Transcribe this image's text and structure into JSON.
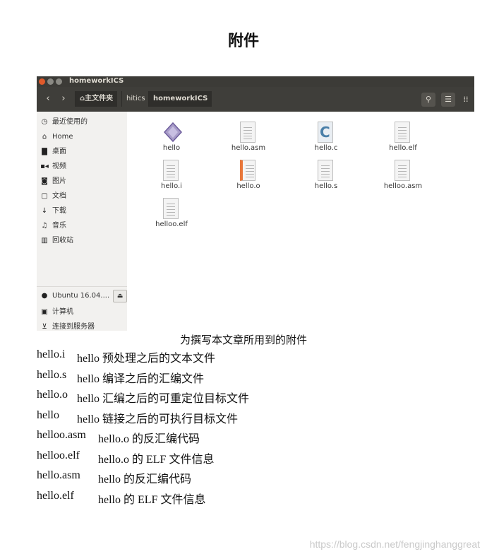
{
  "page": {
    "title": "附件",
    "caption": "为撰写本文章所用到的附件",
    "watermark": "https://blog.csdn.net/fengjinghanggreat"
  },
  "window": {
    "title": "homeworkICS",
    "toolbar": {
      "back_icon": "chevron-left-icon",
      "forward_icon": "chevron-right-icon",
      "breadcrumbs": [
        "主文件夹",
        "hitics",
        "homeworkICS"
      ],
      "search_icon": "search-icon",
      "list_view_icon": "list-view-icon",
      "grid_view_icon": "grid-view-icon"
    },
    "sidebar": {
      "items": [
        {
          "label": "最近使用的",
          "icon": "clock-icon"
        },
        {
          "label": "Home",
          "icon": "home-icon"
        },
        {
          "label": "桌面",
          "icon": "folder-icon"
        },
        {
          "label": "视频",
          "icon": "video-icon"
        },
        {
          "label": "图片",
          "icon": "camera-icon"
        },
        {
          "label": "文档",
          "icon": "document-icon"
        },
        {
          "label": "下载",
          "icon": "download-icon"
        },
        {
          "label": "音乐",
          "icon": "music-icon"
        },
        {
          "label": "回收站",
          "icon": "trash-icon"
        },
        {
          "label": "Ubuntu 16.04....",
          "icon": "disk-icon"
        },
        {
          "label": "计算机",
          "icon": "computer-icon"
        },
        {
          "label": "连接到服务器",
          "icon": "server-icon"
        }
      ]
    },
    "files": [
      {
        "name": "hello",
        "icon": "executable-icon"
      },
      {
        "name": "hello.asm",
        "icon": "text-file-icon"
      },
      {
        "name": "hello.c",
        "icon": "c-source-icon"
      },
      {
        "name": "hello.elf",
        "icon": "text-file-icon"
      },
      {
        "name": "hello.i",
        "icon": "text-file-icon"
      },
      {
        "name": "hello.o",
        "icon": "object-file-icon"
      },
      {
        "name": "hello.s",
        "icon": "text-file-icon"
      },
      {
        "name": "helloo.asm",
        "icon": "text-file-icon"
      },
      {
        "name": "helloo.elf",
        "icon": "text-file-icon"
      }
    ]
  },
  "descriptions": [
    {
      "file": "hello.i",
      "desc": "hello 预处理之后的文本文件"
    },
    {
      "file": "hello.s",
      "desc": "hello 编译之后的汇编文件"
    },
    {
      "file": "hello.o",
      "desc": "hello 汇编之后的可重定位目标文件"
    },
    {
      "file": "hello",
      "desc": "hello 链接之后的可执行目标文件"
    },
    {
      "file": "helloo.asm",
      "desc": "hello.o 的反汇编代码"
    },
    {
      "file": "helloo.elf",
      "desc": "hello.o 的 ELF 文件信息"
    },
    {
      "file": "hello.asm",
      "desc": "hello 的反汇编代码"
    },
    {
      "file": "hello.elf",
      "desc": "hello 的 ELF 文件信息"
    }
  ]
}
